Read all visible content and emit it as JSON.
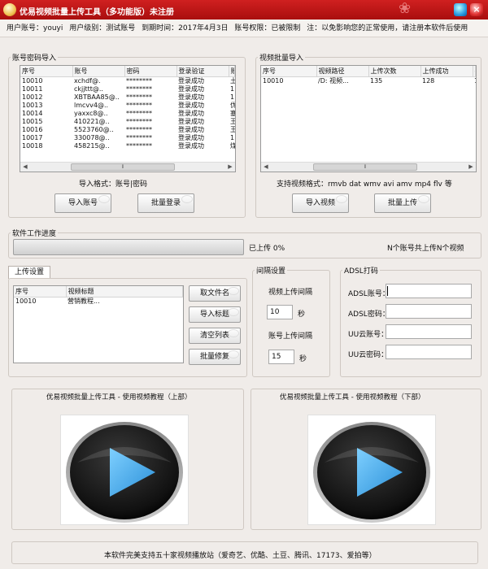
{
  "window": {
    "title": "优易视频批量上传工具（多功能版）未注册"
  },
  "info_bar": {
    "user_account": "用户账号：youyi",
    "user_level": "用户级别：测试账号",
    "expire": "到期时间：2017年4月3日",
    "permission": "账号权限：已被限制",
    "notice": "注：以免影响您的正常使用，请注册本软件后使用"
  },
  "account_import": {
    "legend": "账号密码导入",
    "columns": [
      "序号",
      "账号",
      "密码",
      "登录验证",
      "账"
    ],
    "rows": [
      [
        "10010",
        "xchdf@.",
        "********",
        "登录成功",
        "土"
      ],
      [
        "10011",
        "ckjjttt@..",
        "********",
        "登录成功",
        "1"
      ],
      [
        "10012",
        "XBTBAA85@..",
        "********",
        "登录成功",
        "1"
      ],
      [
        "10013",
        "lmcvv4@..",
        "********",
        "登录成功",
        "优"
      ],
      [
        "10014",
        "yaxxc8@..",
        "********",
        "登录成功",
        "塞"
      ],
      [
        "10015",
        "410221@..",
        "********",
        "登录成功",
        "王"
      ],
      [
        "10016",
        "5523760@..",
        "********",
        "登录成功",
        "王"
      ],
      [
        "10017",
        "330078@..",
        "********",
        "登录成功",
        "1"
      ],
      [
        "10018",
        "458215@..",
        "********",
        "登录成功",
        "煤"
      ]
    ],
    "format_hint": "导入格式：账号|密码",
    "import_button": "导入账号",
    "login_button": "批量登录"
  },
  "video_import": {
    "legend": "视频批量导入",
    "columns": [
      "序号",
      "视频路径",
      "上传次数",
      "上传成功",
      "共"
    ],
    "rows": [
      [
        "10010",
        "/D: 视频...",
        "135",
        "128",
        "1"
      ]
    ],
    "format_hint": "支持视频格式：rmvb dat wmv avi amv mp4 flv 等",
    "import_button": "导入视频",
    "upload_button": "批量上传"
  },
  "progress_section": {
    "legend": "软件工作进度",
    "uploaded_label": "已上传 0%",
    "progress": 0,
    "summary": "N个账号共上传N个视频"
  },
  "upload_settings": {
    "tab_label": "上传设置",
    "columns": [
      "序号",
      "视频标题"
    ],
    "rows": [
      [
        "10010",
        "营销教程..."
      ]
    ],
    "buttons": [
      "取文件名",
      "导入标题",
      "清空列表",
      "批量修复"
    ]
  },
  "interval_settings": {
    "legend": "间隔设置",
    "video_interval_label": "视频上传间隔",
    "video_interval_value": "10",
    "video_interval_unit": "秒",
    "account_interval_label": "账号上传间隔",
    "account_interval_value": "15",
    "account_interval_unit": "秒"
  },
  "adsl": {
    "legend": "ADSL打码",
    "fields": [
      {
        "label": "ADSL账号：",
        "value": ""
      },
      {
        "label": "ADSL密码：",
        "value": ""
      },
      {
        "label": "UU云账号：",
        "value": ""
      },
      {
        "label": "UU云密码：",
        "value": ""
      }
    ]
  },
  "tutorials": {
    "left_title": "优易视频批量上传工具 - 使用视频教程（上部）",
    "right_title": "优易视频批量上传工具 - 使用视频教程（下部）",
    "play_icon": "play-icon"
  },
  "footer": {
    "text": "本软件完美支持五十家视频播放站（爱奇艺、优酷、土豆、腾讯、17173、爱拍等）"
  },
  "colors": {
    "titlebar": "#c01818",
    "window_bg": "#f0ece9",
    "play_button": "#4fb0f0",
    "progress_fill": "#4caf50"
  }
}
